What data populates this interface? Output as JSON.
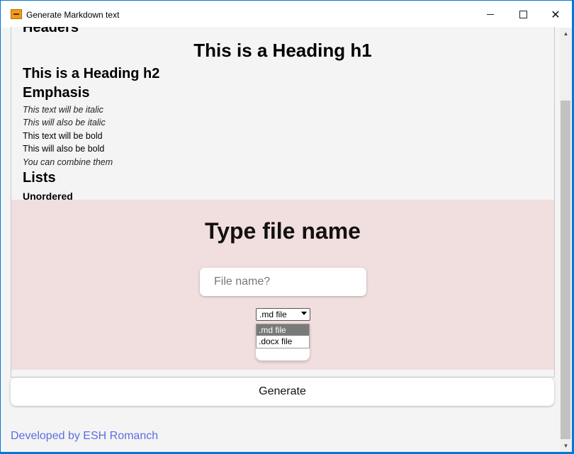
{
  "window": {
    "title": "Generate Markdown text",
    "controls": {
      "minimize": "minimize",
      "maximize": "maximize",
      "close": "✕"
    }
  },
  "preview": {
    "headers_heading": "Headers",
    "h1": "This is a Heading h1",
    "h2": "This is a Heading h2",
    "emphasis_heading": "Emphasis",
    "lines": [
      "This text will be italic",
      "This will also be italic",
      "This text will be bold",
      "This will also be bold",
      "You can combine them"
    ],
    "lists_heading": "Lists",
    "unordered_heading": "Unordered"
  },
  "form": {
    "title": "Type file name",
    "filename_placeholder": "File name?",
    "file_type": {
      "selected": ".md file",
      "options": [
        ".md file",
        ".docx file"
      ]
    }
  },
  "generate_label": "Generate",
  "footer": {
    "developer_link": "Developed by ESH Romanch"
  },
  "colors": {
    "form_background": "#f1dede",
    "link": "#5b6ee0",
    "window_border": "#0078d7"
  }
}
